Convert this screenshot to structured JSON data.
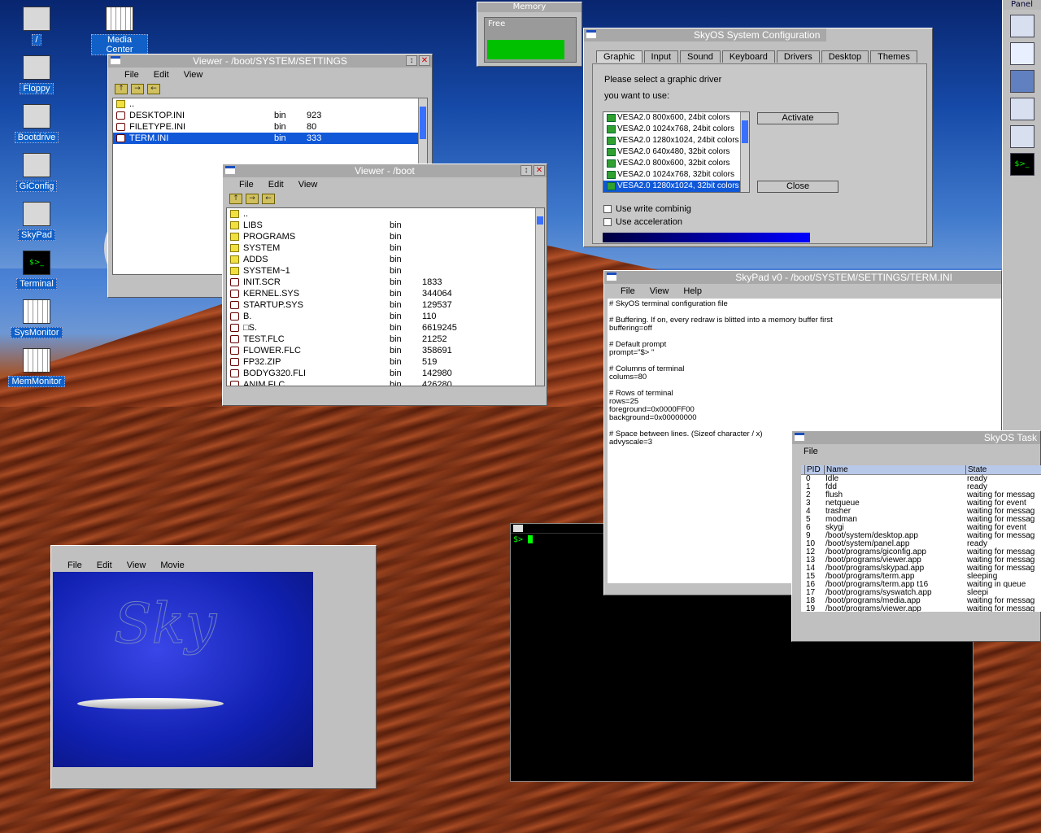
{
  "desktop": {
    "icons": [
      {
        "label": "/",
        "icon": "computer-icon"
      },
      {
        "label": "Media Center",
        "icon": "chart-icon"
      },
      {
        "label": "Floppy",
        "icon": "floppy-icon"
      },
      {
        "label": "Bootdrive",
        "icon": "drive-icon"
      },
      {
        "label": "GiConfig",
        "icon": "config-icon"
      },
      {
        "label": "SkyPad",
        "icon": "notepad-icon"
      },
      {
        "label": "Terminal",
        "icon": "terminal-icon"
      },
      {
        "label": "SysMonitor",
        "icon": "chart-icon"
      },
      {
        "label": "MemMonitor",
        "icon": "chart-icon"
      }
    ]
  },
  "memory": {
    "title": "Memory",
    "label": "Free",
    "fill_color": "#00c000",
    "free_fraction": 0.9
  },
  "panel": {
    "title": "Panel"
  },
  "viewer1": {
    "title": "Viewer - /boot/SYSTEM/SETTINGS",
    "menu": [
      "File",
      "Edit",
      "View"
    ],
    "rows": [
      {
        "name": "..",
        "type": "",
        "size": "",
        "kind": "folder"
      },
      {
        "name": "DESKTOP.INI",
        "type": "bin",
        "size": "923",
        "kind": "file"
      },
      {
        "name": "FILETYPE.INI",
        "type": "bin",
        "size": "80",
        "kind": "file"
      },
      {
        "name": "TERM.INI",
        "type": "bin",
        "size": "333",
        "kind": "file",
        "selected": true
      }
    ]
  },
  "viewer2": {
    "title": "Viewer - /boot",
    "menu": [
      "File",
      "Edit",
      "View"
    ],
    "rows": [
      {
        "name": "..",
        "type": "",
        "size": "",
        "kind": "folder"
      },
      {
        "name": "LIBS",
        "type": "bin",
        "size": "",
        "kind": "folder"
      },
      {
        "name": "PROGRAMS",
        "type": "bin",
        "size": "",
        "kind": "folder"
      },
      {
        "name": "SYSTEM",
        "type": "bin",
        "size": "",
        "kind": "folder"
      },
      {
        "name": "ADDS",
        "type": "bin",
        "size": "",
        "kind": "folder"
      },
      {
        "name": "SYSTEM~1",
        "type": "bin",
        "size": "",
        "kind": "folder"
      },
      {
        "name": "INIT.SCR",
        "type": "bin",
        "size": "1833",
        "kind": "file"
      },
      {
        "name": "KERNEL.SYS",
        "type": "bin",
        "size": "344064",
        "kind": "file"
      },
      {
        "name": "STARTUP.SYS",
        "type": "bin",
        "size": "129537",
        "kind": "file"
      },
      {
        "name": "B.",
        "type": "bin",
        "size": "110",
        "kind": "file"
      },
      {
        "name": "□S.",
        "type": "bin",
        "size": "6619245",
        "kind": "file"
      },
      {
        "name": "TEST.FLC",
        "type": "bin",
        "size": "21252",
        "kind": "file"
      },
      {
        "name": "FLOWER.FLC",
        "type": "bin",
        "size": "358691",
        "kind": "file"
      },
      {
        "name": "FP32.ZIP",
        "type": "bin",
        "size": "519",
        "kind": "file"
      },
      {
        "name": "BODYG320.FLI",
        "type": "bin",
        "size": "142980",
        "kind": "file"
      },
      {
        "name": "ANIM.FLC",
        "type": "bin",
        "size": "426280",
        "kind": "file"
      }
    ]
  },
  "config": {
    "title": "SkyOS System Configuration",
    "tabs": [
      "Graphic",
      "Input",
      "Sound",
      "Keyboard",
      "Drivers",
      "Desktop",
      "Themes"
    ],
    "prompt1": "Please select a graphic driver",
    "prompt2": "you want to use:",
    "drivers": [
      "VESA2.0 800x600, 24bit colors",
      "VESA2.0 1024x768, 24bit colors",
      "VESA2.0 1280x1024, 24bit colors",
      "VESA2.0 640x480, 32bit colors",
      "VESA2.0 800x600, 32bit colors",
      "VESA2.0 1024x768, 32bit colors",
      "VESA2.0 1280x1024, 32bit colors"
    ],
    "activate": "Activate",
    "close": "Close",
    "opt1": "Use write combinig",
    "opt2": "Use acceleration"
  },
  "skypad": {
    "title": "SkyPad v0 - /boot/SYSTEM/SETTINGS/TERM.INI",
    "menu": [
      "File",
      "View",
      "Help"
    ],
    "lines": [
      "# SkyOS terminal configuration file",
      "",
      "# Buffering. If on, every redraw is blitted into a memory buffer first",
      "buffering=off",
      "",
      "# Default prompt",
      "prompt=\"$> \"",
      "",
      "# Columns of terminal",
      "colums=80",
      "",
      "# Rows of terminal",
      "rows=25",
      "foreground=0x0000FF00",
      "background=0x00000000",
      "",
      "# Space between lines. (Sizeof character / x)",
      "advyscale=3"
    ]
  },
  "tasks": {
    "title": "SkyOS Task",
    "menu": [
      "File"
    ],
    "headers": [
      "PID",
      "Name",
      "State"
    ],
    "rows": [
      [
        "0",
        "Idle",
        "ready"
      ],
      [
        "1",
        "fdd",
        "ready"
      ],
      [
        "2",
        "flush",
        "waiting for messag"
      ],
      [
        "3",
        "netqueue",
        "waiting for event"
      ],
      [
        "4",
        "trasher",
        "waiting for messag"
      ],
      [
        "5",
        "modman",
        "waiting for messag"
      ],
      [
        "6",
        "skygi",
        "waiting for event"
      ],
      [
        "9",
        "/boot/system/desktop.app",
        "waiting for messag"
      ],
      [
        "10",
        "/boot/system/panel.app",
        "ready"
      ],
      [
        "12",
        "/boot/programs/giconfig.app",
        "waiting for messag"
      ],
      [
        "13",
        "/boot/programs/viewer.app",
        "waiting for messag"
      ],
      [
        "14",
        "/boot/programs/skypad.app",
        "waiting for messag"
      ],
      [
        "15",
        "/boot/programs/term.app",
        "sleeping"
      ],
      [
        "16",
        "/boot/programs/term.app t16",
        "waiting in queue"
      ],
      [
        "17",
        "/boot/programs/syswatch.app",
        "sleepi"
      ],
      [
        "18",
        "/boot/programs/media.app",
        "waiting for messag"
      ],
      [
        "19",
        "/boot/programs/viewer.app",
        "waiting for messag"
      ]
    ]
  },
  "media": {
    "menu": [
      "File",
      "Edit",
      "View",
      "Movie"
    ]
  },
  "terminal": {
    "prompt": "$>"
  }
}
